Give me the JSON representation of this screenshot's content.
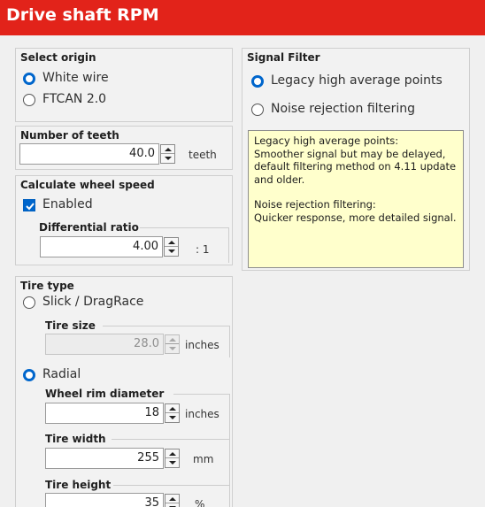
{
  "window": {
    "title": "Drive shaft RPM"
  },
  "origin": {
    "header": "Select origin",
    "options": [
      {
        "label": "White wire",
        "selected": true
      },
      {
        "label": "FTCAN 2.0",
        "selected": false
      }
    ]
  },
  "teeth": {
    "header": "Number of teeth",
    "value": "40.0",
    "unit": "teeth"
  },
  "wheel_speed": {
    "header": "Calculate wheel speed",
    "enabled_label": "Enabled",
    "enabled": true,
    "ratio_label": "Differential ratio",
    "ratio_value": "4.00",
    "ratio_unit": ": 1"
  },
  "tire": {
    "header": "Tire type",
    "slick_label": "Slick / DragRace",
    "slick_selected": false,
    "tire_size_label": "Tire size",
    "tire_size_value": "28.0",
    "tire_size_unit": "inches",
    "radial_label": "Radial",
    "radial_selected": true,
    "rim_label": "Wheel rim diameter",
    "rim_value": "18",
    "rim_unit": "inches",
    "width_label": "Tire width",
    "width_value": "255",
    "width_unit": "mm",
    "height_label": "Tire height",
    "height_value": "35",
    "height_unit": "%"
  },
  "filter": {
    "header": "Signal Filter",
    "options": [
      {
        "label": "Legacy high average points",
        "selected": true
      },
      {
        "label": "Noise rejection filtering",
        "selected": false
      }
    ],
    "note": {
      "line1": "Legacy high average points:",
      "line2": "Smoother signal but may be delayed,",
      "line3": "default filtering method on 4.11 update",
      "line4": "and older.",
      "line5": "Noise rejection filtering:",
      "line6": "Quicker response, more detailed signal."
    }
  },
  "colors": {
    "title_bar": "#e2231a",
    "accent": "#0066cc",
    "note_bg": "#ffffcc"
  }
}
